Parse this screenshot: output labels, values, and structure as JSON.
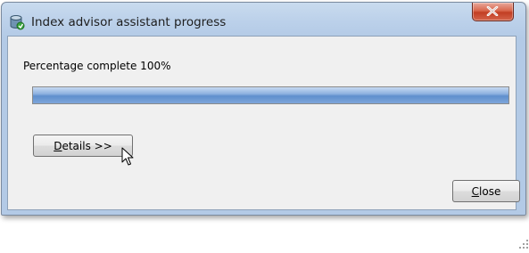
{
  "window": {
    "title": "Index advisor assistant progress",
    "title_icon": "database-icon",
    "close_icon": "close-icon"
  },
  "progress": {
    "label": "Percentage complete 100%",
    "percent": 100,
    "fill_color": "#6a96d2"
  },
  "buttons": {
    "details": {
      "mnemonic": "D",
      "rest": "etails >>"
    },
    "close": {
      "mnemonic": "C",
      "rest": "lose"
    }
  },
  "pointer": "mouse-pointer-icon"
}
